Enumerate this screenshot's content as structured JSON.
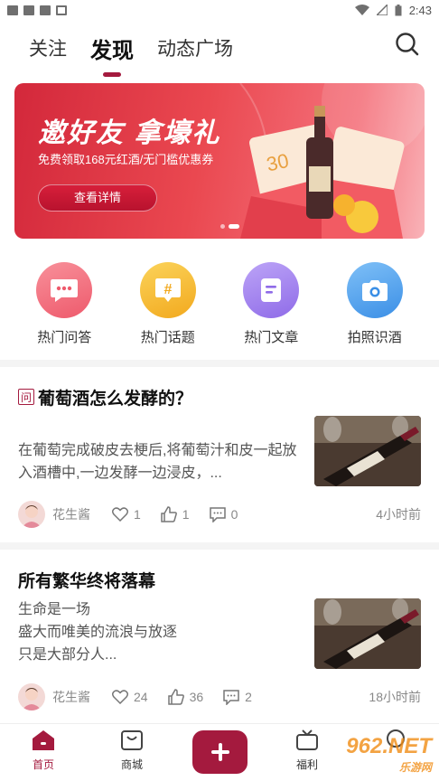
{
  "status_bar": {
    "time": "2:43"
  },
  "top_tabs": [
    {
      "label": "关注",
      "active": false
    },
    {
      "label": "发现",
      "active": true
    },
    {
      "label": "动态广场",
      "active": false
    }
  ],
  "banner": {
    "title": "邀好友 拿壕礼",
    "subtitle": "免费领取168元红酒/无门槛优惠券",
    "button": "查看详情"
  },
  "quick_entries": [
    {
      "label": "热门问答",
      "icon": "chat-bubble-icon",
      "color": "#f06b7c"
    },
    {
      "label": "热门话题",
      "icon": "hashtag-icon",
      "color": "#f6c02c"
    },
    {
      "label": "热门文章",
      "icon": "document-icon",
      "color": "#a783f0"
    },
    {
      "label": "拍照识酒",
      "icon": "camera-icon",
      "color": "#55a6ee"
    }
  ],
  "feed": [
    {
      "badge": "问",
      "title": "葡萄酒怎么发酵的？",
      "body": "在葡萄完成破皮去梗后,将葡萄汁和皮一起放入酒槽中,一边发酵一边浸皮，...",
      "author": "花生酱",
      "likes": "1",
      "thumbs": "1",
      "comments": "0",
      "time": "4小时前"
    },
    {
      "badge": "",
      "title": "所有繁华终将落幕",
      "body": "生命是一场\n盛大而唯美的流浪与放逐\n只是大部分人...",
      "author": "花生酱",
      "likes": "24",
      "thumbs": "36",
      "comments": "2",
      "time": "18小时前"
    }
  ],
  "bottom_nav": [
    {
      "label": "首页",
      "active": true
    },
    {
      "label": "商城",
      "active": false
    },
    {
      "label": "福利",
      "active": false
    }
  ],
  "watermark": {
    "brand": "962.NET",
    "sub": "乐游网"
  },
  "colors": {
    "accent": "#a41a3e"
  }
}
